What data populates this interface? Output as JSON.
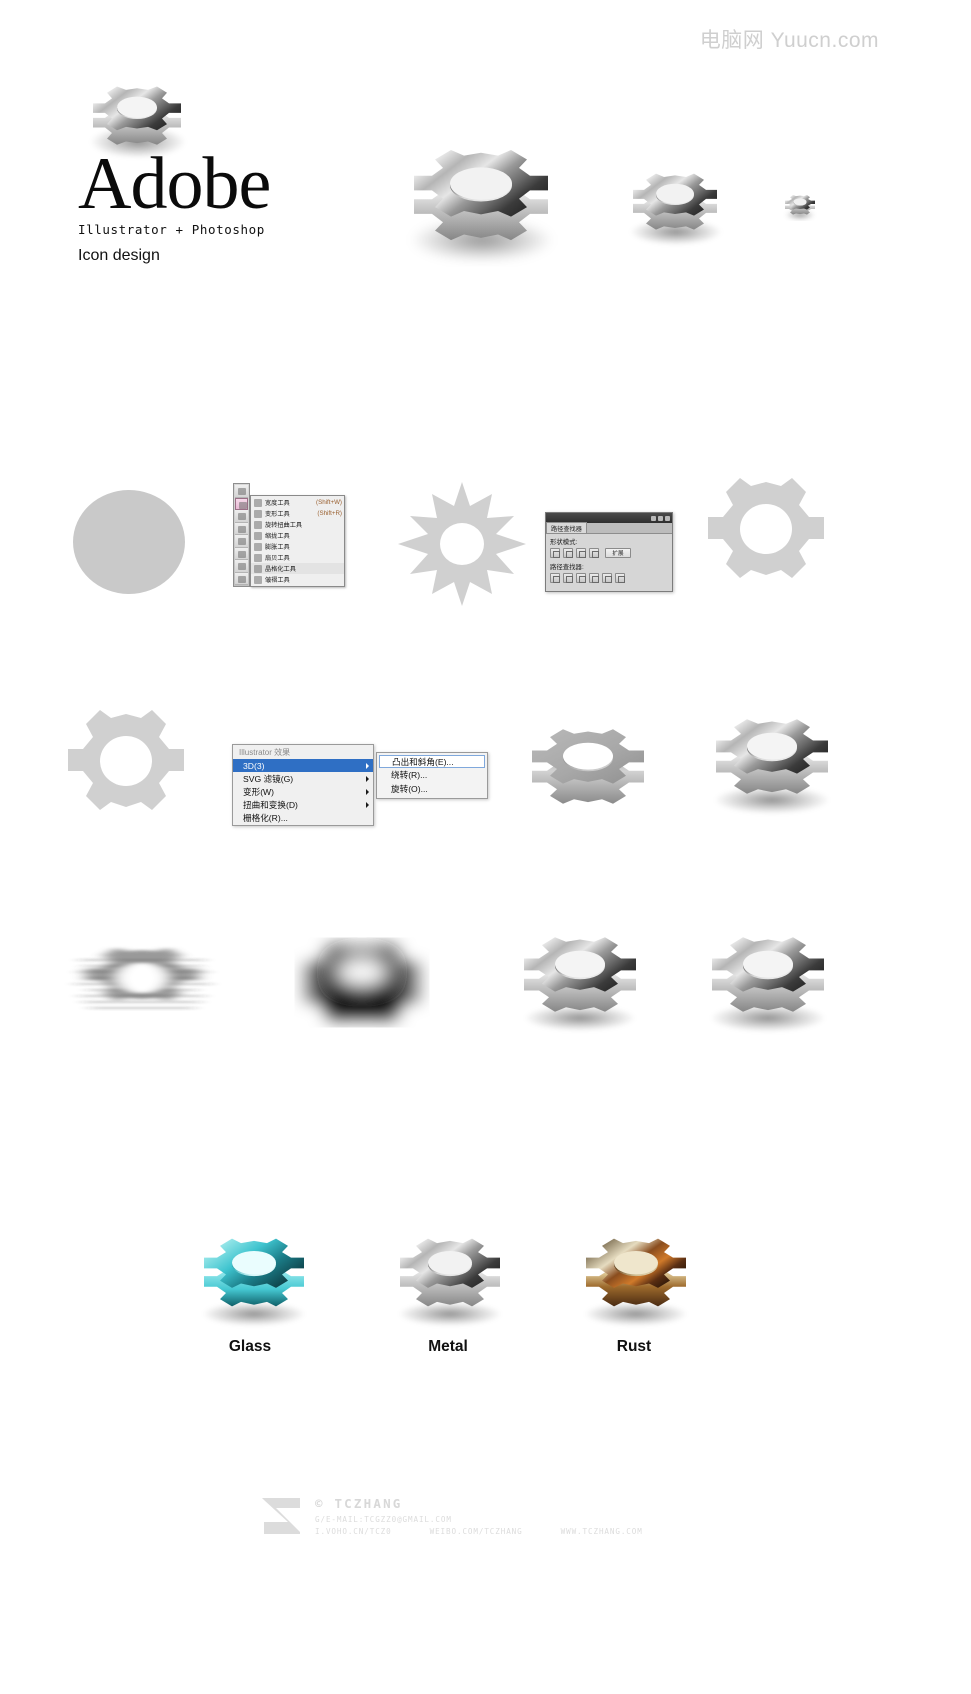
{
  "watermark": {
    "top": "电脑网 Yuucn.com"
  },
  "header": {
    "brand": "Adobe",
    "apps": "Illustrator  +  Photoshop",
    "subtitle": "Icon design"
  },
  "row1": {
    "caption": "gear icon sizes preview",
    "gears": [
      {
        "name": "gear-logo-large",
        "size": 112
      },
      {
        "name": "gear-preview-128",
        "size": 168
      },
      {
        "name": "gear-preview-64",
        "size": 112
      },
      {
        "name": "gear-preview-16",
        "size": 34
      }
    ]
  },
  "ai_tools_panel": {
    "title": "Illustrator tool flyout",
    "items": [
      {
        "label": "宽度工具",
        "shortcut": "(Shift+W)",
        "selected": false
      },
      {
        "label": "变形工具",
        "shortcut": "(Shift+R)",
        "selected": false
      },
      {
        "label": "旋转扭曲工具",
        "shortcut": "",
        "selected": false
      },
      {
        "label": "缩拢工具",
        "shortcut": "",
        "selected": false
      },
      {
        "label": "膨胀工具",
        "shortcut": "",
        "selected": false
      },
      {
        "label": "扇贝工具",
        "shortcut": "",
        "selected": false
      },
      {
        "label": "晶格化工具",
        "shortcut": "",
        "selected": true
      },
      {
        "label": "皱褶工具",
        "shortcut": "",
        "selected": false
      }
    ]
  },
  "pathfinder_panel": {
    "tab": "路径查找器",
    "shape_modes_label": "形状模式:",
    "pathfinders_label": "路径查找器:",
    "expand_button": "扩展",
    "shape_mode_count": 4,
    "pathfinder_count": 6
  },
  "fx_menu": {
    "header": "Illustrator 效果",
    "items": [
      {
        "label": "3D(3)",
        "submenu": true,
        "active": true
      },
      {
        "label": "SVG 滤镜(G)",
        "submenu": true,
        "active": false
      },
      {
        "label": "变形(W)",
        "submenu": true,
        "active": false
      },
      {
        "label": "扭曲和变换(D)",
        "submenu": true,
        "active": false
      },
      {
        "label": "栅格化(R)...",
        "submenu": false,
        "active": false
      }
    ],
    "submenu": [
      {
        "label": "凸出和斜角(E)...",
        "selected": true
      },
      {
        "label": "绕转(R)...",
        "selected": false
      },
      {
        "label": "旋转(O)...",
        "selected": false
      }
    ]
  },
  "materials": [
    {
      "label": "Glass",
      "color": "#3fc4cf"
    },
    {
      "label": "Metal",
      "color": "#b9b9b9"
    },
    {
      "label": "Rust",
      "color": "#9a7344"
    }
  ],
  "footer": {
    "copyright": "© TCZHANG",
    "email": "G/E-MAIL:TCGZZ0@GMAIL.COM",
    "links": [
      "I.VOHO.CN/TCZ0",
      "WEIBO.COM/TCZHANG",
      "WWW.TCZHANG.COM"
    ]
  },
  "colors": {
    "flat_gray": "#c9c9c9",
    "metal_light": "#e8e8e8",
    "metal_dark": "#4a4a4a",
    "background": "#ffffff"
  }
}
